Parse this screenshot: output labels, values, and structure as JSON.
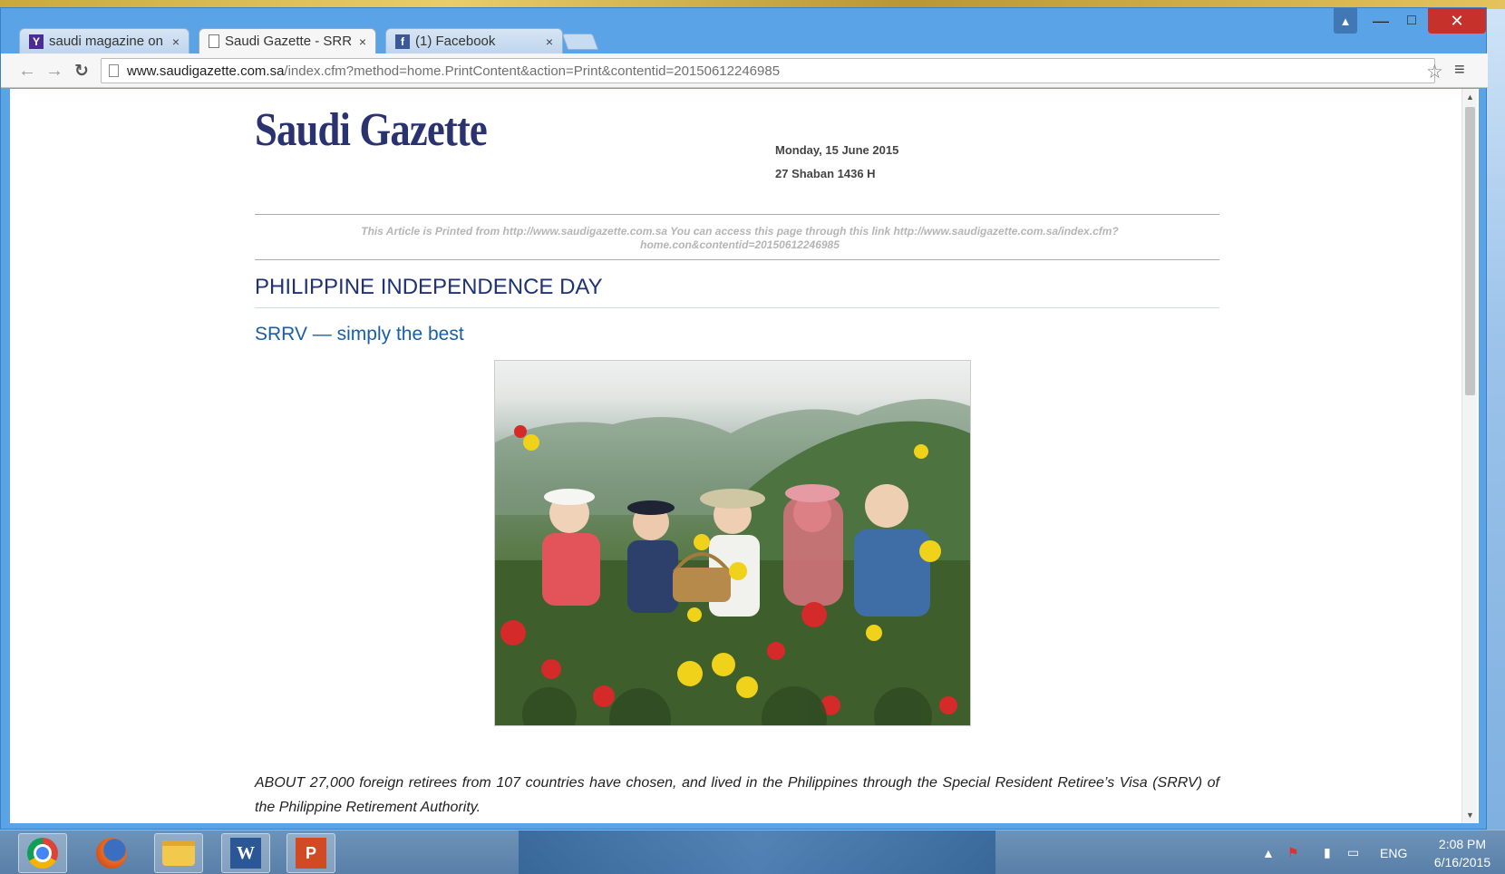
{
  "browser": {
    "tabs": [
      {
        "label": "saudi magazine on sr",
        "favicon": "yahoo-icon"
      },
      {
        "label": "Saudi Gazette - SRRV",
        "favicon": "page-icon",
        "active": true
      },
      {
        "label": "(1) Facebook",
        "favicon": "facebook-icon"
      }
    ],
    "tab_close": "×",
    "url_host": "www.saudigazette.com.sa",
    "url_path": "/index.cfm?method=home.PrintContent&action=Print&contentid=20150612246985"
  },
  "page": {
    "logo": "Saudi Gazette",
    "date_gregorian": "Monday, 15 June 2015",
    "date_hijri": "27 Shaban 1436 H",
    "notice": "This Article is Printed from http://www.saudigazette.com.sa  You can access this page through this link  http://www.saudigazette.com.sa/index.cfm?home.con&contentid=20150612246985",
    "section": "PHILIPPINE INDEPENDENCE DAY",
    "headline": "SRRV — simply the best",
    "body": "ABOUT 27,000 foreign retirees from 107 countries have chosen, and lived in the Philippines through the Special Resident Retiree’s Visa (SRRV) of the Philippine Retirement Authority."
  },
  "taskbar": {
    "apps": [
      "chrome-icon",
      "firefox-icon",
      "file-explorer-icon",
      "word-icon",
      "powerpoint-icon"
    ],
    "language": "ENG",
    "time": "2:08 PM",
    "date": "6/16/2015"
  },
  "colors": {
    "logo": "#2a3270",
    "section": "#1f3276",
    "headline": "#1b5ea8",
    "close_button": "#c7312b"
  }
}
